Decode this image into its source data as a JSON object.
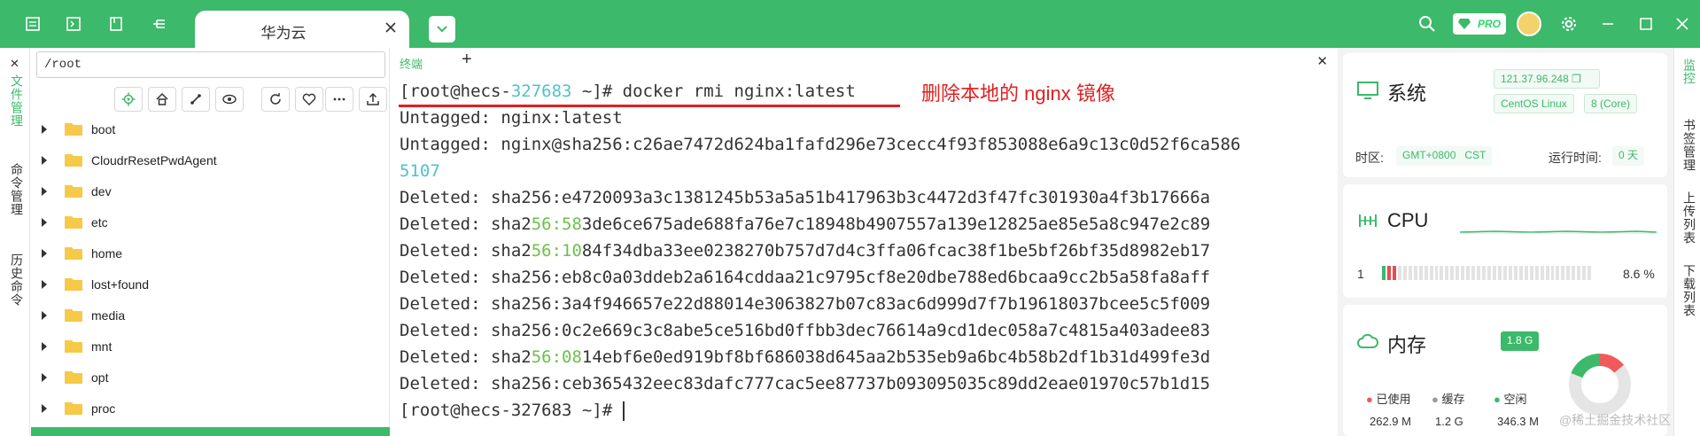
{
  "tab": {
    "label": "华为云"
  },
  "left_rail": {
    "files": "文件管理",
    "commands": "命令管理",
    "history": "历史命令"
  },
  "file_panel": {
    "path": "/root",
    "folders": [
      "boot",
      "CloudrResetPwdAgent",
      "dev",
      "etc",
      "home",
      "lost+found",
      "media",
      "mnt",
      "opt",
      "proc"
    ]
  },
  "terminal": {
    "tab_label": "终端",
    "lines": {
      "l1_prompt_a": "[root@hecs-",
      "l1_host": "327683",
      "l1_rest": " ~]# docker rmi nginx:latest",
      "l2": "Untagged: nginx:latest",
      "l3": "Untagged: nginx@sha256:c26ae7472d624ba1fafd296e73cecc4f93f853088e6a9c13c0d52f6ca586",
      "l4": "5107",
      "l5": "Deleted: sha256:e4720093a3c1381245b53a5a51b417963b3c4472d3f47fc301930a4f3b17666a",
      "l6a": "Deleted: sha2",
      "l6b": "56:58",
      "l6c": "3de6ce675ade688fa76e7c18948b4907557a139e12825ae85e5a8c947e2c89",
      "l7a": "Deleted: sha2",
      "l7b": "56:10",
      "l7c": "84f34dba33ee0238270b757d7d4c3ffa06fcac38f1be5bf26bf35d8982eb17",
      "l8": "Deleted: sha256:eb8c0a03ddeb2a6164cddaa21c9795cf8e20dbe788ed6bcaa9cc2b5a58fa8aff",
      "l9": "Deleted: sha256:3a4f946657e22d88014e3063827b07c83ac6d999d7f7b19618037bcee5c5f009",
      "l10": "Deleted: sha256:0c2e669c3c8abe5ce516bd0ffbb3dec76614a9cd1dec058a7c4815a403adee83",
      "l11a": "Deleted: sha2",
      "l11b": "56:08",
      "l11c": "14ebf6e0ed919bf8bf686038d645aa2b535eb9a6bc4b58b2df1b31d499fe3d",
      "l12": "Deleted: sha256:ceb365432eec83dafc777cac5ee87737b093095035c89dd2eae01970c57b1d15",
      "l13": "[root@hecs-327683 ~]# "
    },
    "annotation": "删除本地的 nginx 镜像"
  },
  "system_card": {
    "title": "系统",
    "ip": "121.37.96.248",
    "os": "CentOS Linux",
    "cores": "8 (Core)",
    "tz_label": "时区:",
    "tz_value": "GMT+0800",
    "tz_name": "CST",
    "uptime_label": "运行时间:",
    "uptime_value": "0 天"
  },
  "cpu_card": {
    "title": "CPU",
    "index": "1",
    "percent": "8.6 %",
    "usage_fraction": 0.086
  },
  "memory_card": {
    "title": "内存",
    "total": "1.8 G",
    "used_label": "已使用",
    "used_value": "262.9 M",
    "cache_label": "缓存",
    "cache_value": "1.2 G",
    "free_label": "空闲",
    "free_value": "346.3 M"
  },
  "right_rail": {
    "monitor": "监控",
    "bookmarks": "书签管理",
    "upload": "上传列表",
    "download": "下载列表"
  },
  "watermark": "@稀土掘金技术社区",
  "pro_badge": "PRO",
  "colors": {
    "accent": "#3cb96a",
    "red": "#e02020",
    "teal": "#4fc3c9"
  }
}
